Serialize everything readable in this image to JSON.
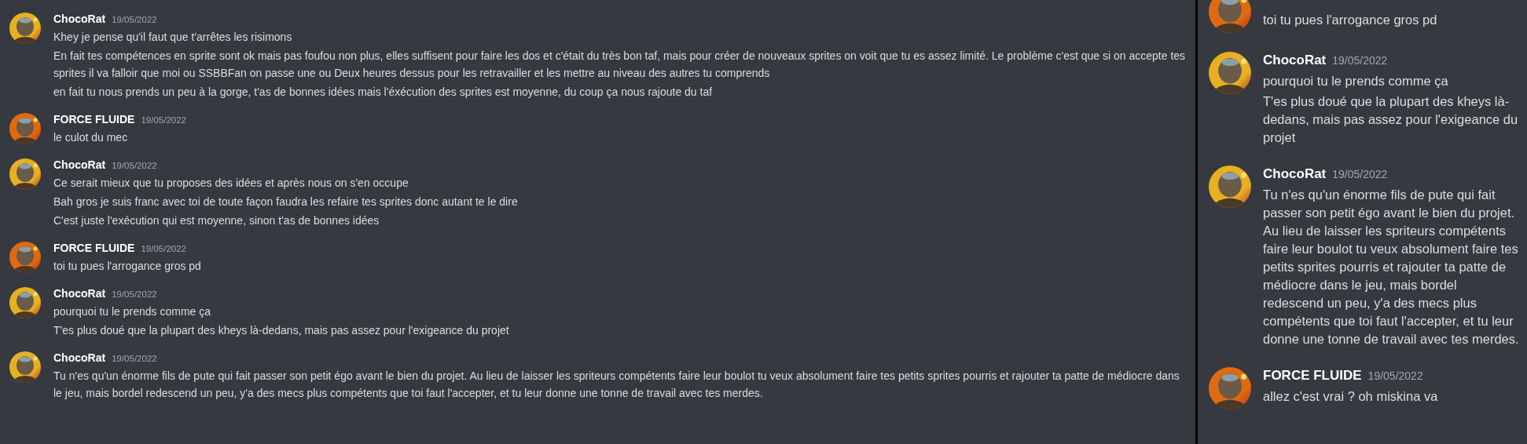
{
  "panels": [
    {
      "groups": [
        {
          "author": "ChocoRat",
          "timestamp": "19/05/2022",
          "avatar": {
            "kind": "picture",
            "color": "#e8b020"
          },
          "messages": [
            "Khey je pense qu'il faut que t'arrêtes les risimons",
            "En fait tes compétences en sprite sont ok mais pas foufou non plus, elles suffisent pour faire les dos et c'était du très bon taf, mais pour créer de nouveaux sprites on voit que tu es assez limité. Le problème c'est que si on accepte tes sprites il va falloir que moi ou SSBBFan on passe une ou Deux heures dessus pour les retravailler et les mettre au niveau des autres tu comprends",
            "en fait tu nous prends un peu à la gorge, t'as de bonnes idées mais l'éxécution des sprites est moyenne, du coup ça nous rajoute du taf"
          ]
        },
        {
          "author": "FORCE FLUIDE",
          "timestamp": "19/05/2022",
          "avatar": {
            "kind": "picture",
            "color": "#e06a10"
          },
          "messages": [
            "le culot du mec"
          ]
        },
        {
          "author": "ChocoRat",
          "timestamp": "19/05/2022",
          "avatar": {
            "kind": "picture",
            "color": "#e8b020"
          },
          "messages": [
            "Ce serait mieux que tu proposes des idées et après nous on s'en occupe",
            "Bah gros je suis franc avec toi de toute façon faudra les refaire tes sprites donc autant te le dire",
            "C'est juste l'exécution qui est moyenne, sinon t'as de bonnes idées"
          ]
        },
        {
          "author": "FORCE FLUIDE",
          "timestamp": "19/05/2022",
          "avatar": {
            "kind": "picture",
            "color": "#e06a10"
          },
          "messages": [
            "toi tu pues l'arrogance gros pd"
          ]
        },
        {
          "author": "ChocoRat",
          "timestamp": "19/05/2022",
          "avatar": {
            "kind": "picture",
            "color": "#e8b020"
          },
          "messages": [
            "pourquoi tu le prends comme ça",
            "T'es plus doué que la plupart des kheys là-dedans, mais pas assez pour l'exigeance du projet"
          ]
        },
        {
          "author": "ChocoRat",
          "timestamp": "19/05/2022",
          "avatar": {
            "kind": "picture",
            "color": "#e8b020"
          },
          "messages": [
            "Tu n'es qu'un énorme fils de pute qui fait passer son petit égo avant le bien du projet. Au lieu de laisser les spriteurs compétents faire leur boulot tu veux absolument faire tes petits sprites pourris et rajouter ta patte de médiocre dans le jeu, mais bordel redescend un peu, y'a des mecs plus compétents que toi faut l'accepter, et tu leur donne une tonne de travail avec tes merdes."
          ]
        }
      ]
    },
    {
      "groups": [
        {
          "avatar": {
            "kind": "picture",
            "color": "#e06a10"
          },
          "messages": [
            "toi tu pues l'arrogance gros pd"
          ]
        },
        {
          "author": "ChocoRat",
          "timestamp": "19/05/2022",
          "avatar": {
            "kind": "picture",
            "color": "#e8b020"
          },
          "messages": [
            "pourquoi tu le prends comme ça",
            "T'es plus doué que la plupart des kheys là-dedans, mais pas assez pour l'exigeance du projet"
          ]
        },
        {
          "author": "ChocoRat",
          "timestamp": "19/05/2022",
          "avatar": {
            "kind": "picture",
            "color": "#e8b020"
          },
          "messages": [
            "Tu n'es qu'un énorme fils de pute qui fait passer son petit égo avant le bien du projet. Au lieu de laisser les spriteurs compétents faire leur boulot tu veux absolument faire tes petits sprites pourris et rajouter ta patte de médiocre dans le jeu, mais bordel redescend un peu, y'a des mecs plus compétents que toi faut l'accepter, et tu leur donne une tonne de travail avec tes merdes."
          ]
        },
        {
          "author": "FORCE FLUIDE",
          "timestamp": "19/05/2022",
          "avatar": {
            "kind": "picture",
            "color": "#e06a10"
          },
          "messages": [
            "allez c'est vrai ? oh miskina va"
          ]
        }
      ]
    }
  ]
}
